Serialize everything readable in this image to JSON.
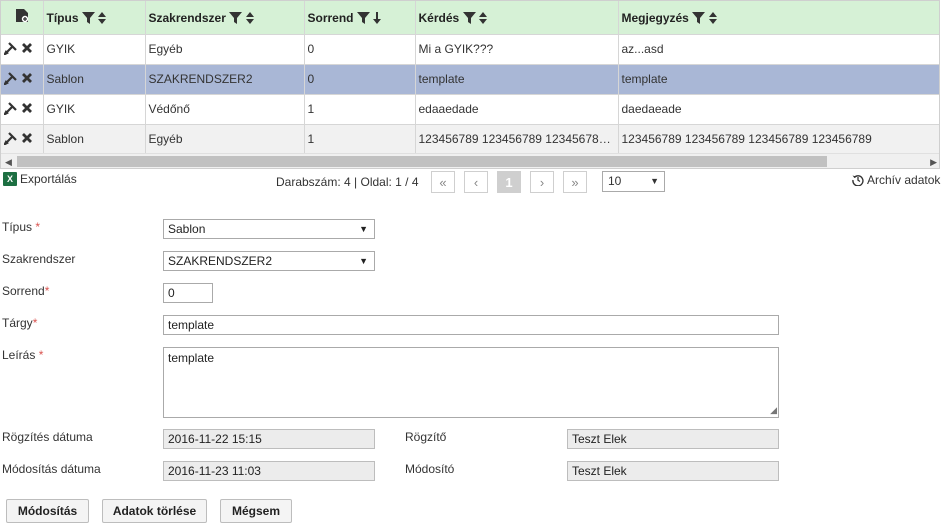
{
  "grid": {
    "columns": [
      "Típus",
      "Szakrendszer",
      "Sorrend",
      "Kérdés",
      "Megjegyzés"
    ],
    "rows": [
      {
        "tipus": "GYIK",
        "szakrendszer": "Egyéb",
        "sorrend": "0",
        "kerdes": "Mi a GYIK???",
        "megjegyzes": "az...asd"
      },
      {
        "tipus": "Sablon",
        "szakrendszer": "SZAKRENDSZER2",
        "sorrend": "0",
        "kerdes": "template",
        "megjegyzes": "template"
      },
      {
        "tipus": "GYIK",
        "szakrendszer": "Védőnő",
        "sorrend": "1",
        "kerdes": "edaaedade",
        "megjegyzes": "daedaeade"
      },
      {
        "tipus": "Sablon",
        "szakrendszer": "Egyéb",
        "sorrend": "1",
        "kerdes": "123456789 123456789 123456789...",
        "megjegyzes": "123456789 123456789 123456789 123456789"
      }
    ],
    "selected_row": 1
  },
  "pager": {
    "export_label": "Exportálás",
    "info": "Darabszám: 4 | Oldal: 1 / 4",
    "current_page": "1",
    "page_size": "10",
    "archive_label": "Archív adatok"
  },
  "form": {
    "tipus_label": "Típus",
    "tipus_value": "Sablon",
    "szakrendszer_label": "Szakrendszer",
    "szakrendszer_value": "SZAKRENDSZER2",
    "sorrend_label": "Sorrend",
    "sorrend_value": "0",
    "targy_label": "Tárgy",
    "targy_value": "template",
    "leiras_label": "Leírás",
    "leiras_value": "template",
    "rogzites_datum_label": "Rögzítés dátuma",
    "rogzites_datum_value": "2016-11-22 15:15",
    "rogzito_label": "Rögzítő",
    "rogzito_value": "Teszt Elek",
    "modositas_datum_label": "Módosítás dátuma",
    "modositas_datum_value": "2016-11-23 11:03",
    "modosito_label": "Módosító",
    "modosito_value": "Teszt Elek",
    "required_mark": "*"
  },
  "buttons": {
    "modify": "Módosítás",
    "delete": "Adatok törlése",
    "cancel": "Mégsem"
  },
  "colors": {
    "header_bg": "#d6f1d6",
    "selected_row_bg": "#a9b7d6",
    "required": "#d9534f"
  }
}
